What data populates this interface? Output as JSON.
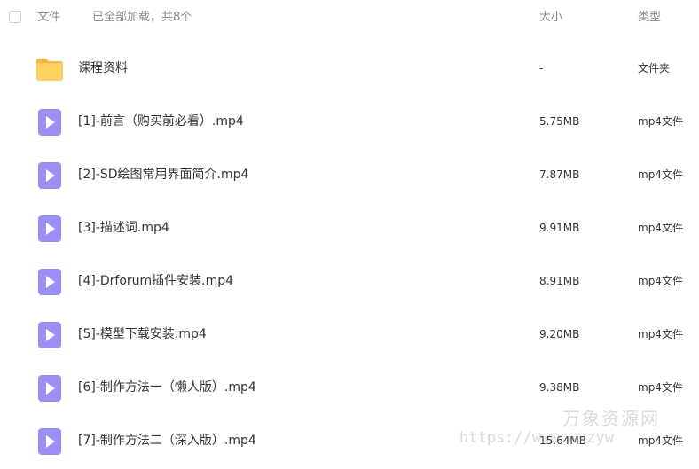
{
  "header": {
    "name_label": "文件",
    "status": "已全部加载，共8个",
    "size_label": "大小",
    "type_label": "类型"
  },
  "files": [
    {
      "name": "课程资料",
      "size": "-",
      "type": "文件夹",
      "icon": "folder-icon"
    },
    {
      "name": "[1]-前言（购买前必看）.mp4",
      "size": "5.75MB",
      "type": "mp4文件",
      "icon": "video-file-icon"
    },
    {
      "name": "[2]-SD绘图常用界面简介.mp4",
      "size": "7.87MB",
      "type": "mp4文件",
      "icon": "video-file-icon"
    },
    {
      "name": "[3]-描述词.mp4",
      "size": "9.91MB",
      "type": "mp4文件",
      "icon": "video-file-icon"
    },
    {
      "name": "[4]-Drforum插件安装.mp4",
      "size": "8.91MB",
      "type": "mp4文件",
      "icon": "video-file-icon"
    },
    {
      "name": "[5]-模型下载安装.mp4",
      "size": "9.20MB",
      "type": "mp4文件",
      "icon": "video-file-icon"
    },
    {
      "name": "[6]-制作方法一（懒人版）.mp4",
      "size": "9.38MB",
      "type": "mp4文件",
      "icon": "video-file-icon"
    },
    {
      "name": "[7]-制作方法二（深入版）.mp4",
      "size": "15.64MB",
      "type": "mp4文件",
      "icon": "video-file-icon"
    }
  ],
  "watermark": {
    "title": "万象资源网",
    "url": "https://www.wxzyw"
  },
  "colors": {
    "folder": "#FFD15E",
    "video_icon": "#9B8FF5",
    "text": "#333333",
    "muted": "#8A8A8A"
  }
}
